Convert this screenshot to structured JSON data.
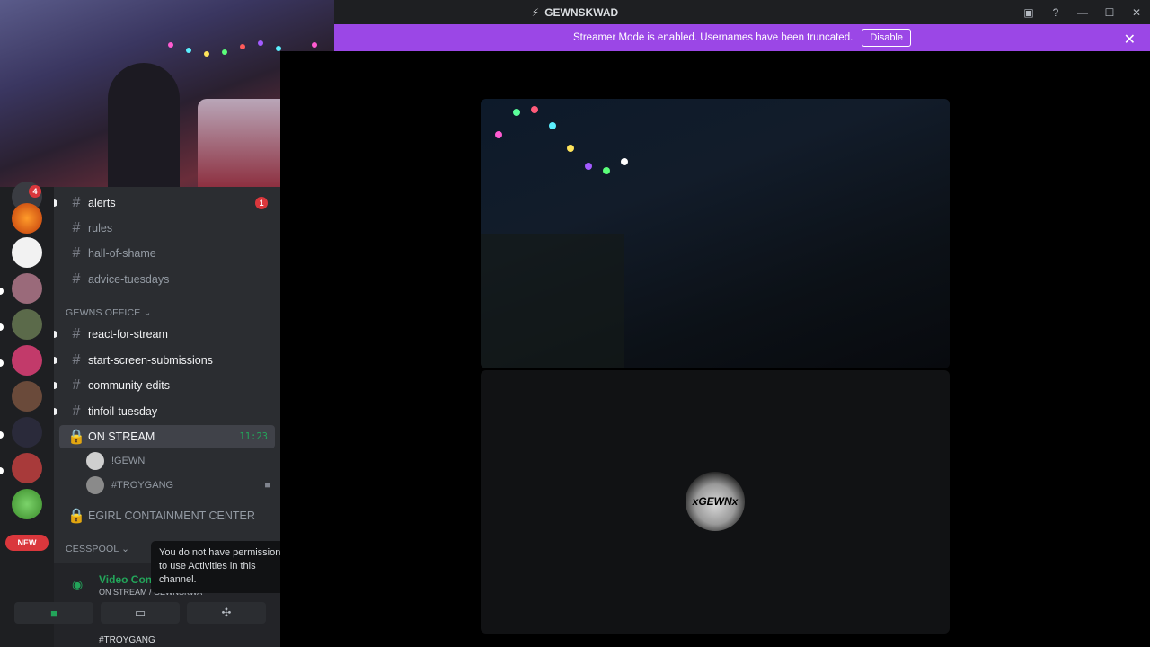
{
  "window": {
    "title": "GEWNSKWAD",
    "inbox_icon": "inbox-icon",
    "help_icon": "help-icon"
  },
  "banner": {
    "message": "Streamer Mode is enabled. Usernames have been truncated.",
    "disable_label": "Disable"
  },
  "guilds": {
    "badge_count": "4",
    "new_label": "NEW"
  },
  "channels": [
    {
      "name": "alerts",
      "type": "text",
      "unread": true,
      "mentions": "1"
    },
    {
      "name": "rules",
      "type": "text",
      "unread": false
    },
    {
      "name": "hall-of-shame",
      "type": "text",
      "unread": false
    },
    {
      "name": "advice-tuesdays",
      "type": "text",
      "unread": false
    }
  ],
  "category_office": "GEWNS OFFICE",
  "office_channels": [
    {
      "name": "react-for-stream"
    },
    {
      "name": "start-screen-submissions"
    },
    {
      "name": "community-edits"
    },
    {
      "name": "tinfoil-tuesday"
    }
  ],
  "voice_channel": {
    "name": "ON STREAM",
    "time": "11:23",
    "users": [
      {
        "name": "!GEWN"
      },
      {
        "name": "#TROYGANG"
      }
    ]
  },
  "locked_channel": {
    "name": "EGIRL CONTAINMENT CENTER"
  },
  "category_cesspool": "CESSPOOL",
  "rtc": {
    "title": "Video Connected",
    "subtitle": "ON STREAM / GEWNSKWA",
    "footer_user": "#TROYGANG"
  },
  "tooltip": {
    "text": "You do not have permissions to use Activities in this channel."
  },
  "stage": {
    "avatar_text": "xGEWNx"
  },
  "colors": {
    "accent": "#9b47e6",
    "connected": "#23a55a",
    "danger": "#da373c"
  }
}
